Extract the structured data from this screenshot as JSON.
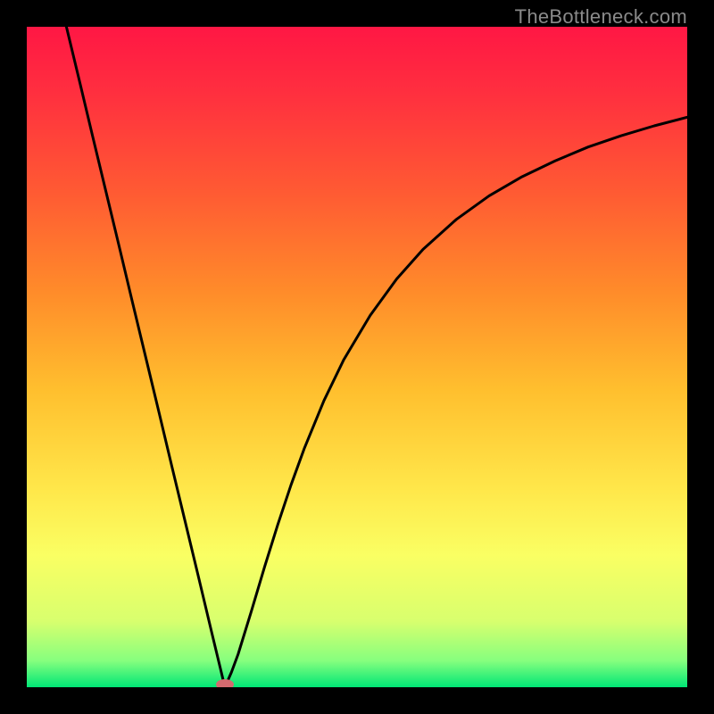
{
  "watermark": "TheBottleneck.com",
  "colors": {
    "frame": "#000000",
    "line": "#000000",
    "marker": "#d46a6f",
    "gradient_stops": [
      {
        "offset": 0.0,
        "color": "#ff1744"
      },
      {
        "offset": 0.1,
        "color": "#ff2f3f"
      },
      {
        "offset": 0.25,
        "color": "#ff5a33"
      },
      {
        "offset": 0.4,
        "color": "#ff8b2a"
      },
      {
        "offset": 0.55,
        "color": "#ffbf2e"
      },
      {
        "offset": 0.7,
        "color": "#ffe74a"
      },
      {
        "offset": 0.8,
        "color": "#faff63"
      },
      {
        "offset": 0.9,
        "color": "#d8ff6e"
      },
      {
        "offset": 0.96,
        "color": "#86ff7e"
      },
      {
        "offset": 1.0,
        "color": "#00e676"
      }
    ]
  },
  "chart_data": {
    "type": "line",
    "title": "",
    "xlabel": "",
    "ylabel": "",
    "xlim": [
      0,
      100
    ],
    "ylim": [
      0,
      100
    ],
    "grid": false,
    "legend": false,
    "min_marker": {
      "x": 30,
      "y": 0
    },
    "series": [
      {
        "name": "curve",
        "points": [
          {
            "x": 6.0,
            "y": 100.0
          },
          {
            "x": 8.0,
            "y": 91.7
          },
          {
            "x": 10.0,
            "y": 83.3
          },
          {
            "x": 12.0,
            "y": 75.0
          },
          {
            "x": 14.0,
            "y": 66.7
          },
          {
            "x": 16.0,
            "y": 58.3
          },
          {
            "x": 18.0,
            "y": 50.0
          },
          {
            "x": 20.0,
            "y": 41.7
          },
          {
            "x": 22.0,
            "y": 33.3
          },
          {
            "x": 24.0,
            "y": 25.0
          },
          {
            "x": 26.0,
            "y": 16.7
          },
          {
            "x": 28.0,
            "y": 8.3
          },
          {
            "x": 30.0,
            "y": 0.0
          },
          {
            "x": 31.0,
            "y": 2.3
          },
          {
            "x": 32.0,
            "y": 5.0
          },
          {
            "x": 34.0,
            "y": 11.5
          },
          {
            "x": 36.0,
            "y": 18.2
          },
          {
            "x": 38.0,
            "y": 24.6
          },
          {
            "x": 40.0,
            "y": 30.6
          },
          {
            "x": 42.0,
            "y": 36.1
          },
          {
            "x": 45.0,
            "y": 43.4
          },
          {
            "x": 48.0,
            "y": 49.6
          },
          {
            "x": 52.0,
            "y": 56.3
          },
          {
            "x": 56.0,
            "y": 61.8
          },
          {
            "x": 60.0,
            "y": 66.3
          },
          {
            "x": 65.0,
            "y": 70.8
          },
          {
            "x": 70.0,
            "y": 74.4
          },
          {
            "x": 75.0,
            "y": 77.3
          },
          {
            "x": 80.0,
            "y": 79.7
          },
          {
            "x": 85.0,
            "y": 81.8
          },
          {
            "x": 90.0,
            "y": 83.5
          },
          {
            "x": 95.0,
            "y": 85.0
          },
          {
            "x": 100.0,
            "y": 86.3
          }
        ]
      }
    ]
  }
}
